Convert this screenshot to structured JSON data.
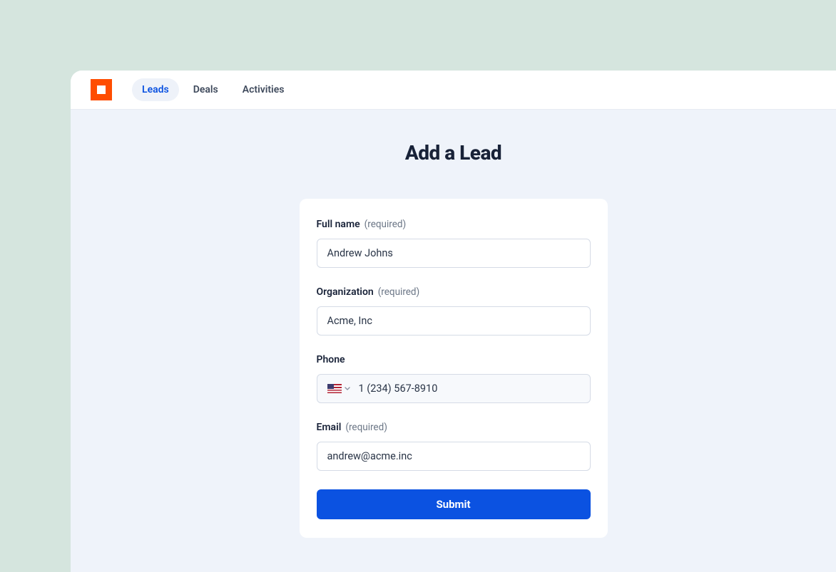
{
  "nav": {
    "tabs": [
      {
        "label": "Leads",
        "active": true
      },
      {
        "label": "Deals",
        "active": false
      },
      {
        "label": "Activities",
        "active": false
      }
    ]
  },
  "page": {
    "title": "Add a Lead"
  },
  "form": {
    "required_hint": "(required)",
    "fullname": {
      "label": "Full name",
      "required": true,
      "value": "Andrew Johns"
    },
    "organization": {
      "label": "Organization",
      "required": true,
      "value": "Acme, Inc"
    },
    "phone": {
      "label": "Phone",
      "required": false,
      "country_flag": "us",
      "value": "1 (234) 567-8910"
    },
    "email": {
      "label": "Email",
      "required": true,
      "value": "andrew@acme.inc"
    },
    "submit_label": "Submit"
  }
}
